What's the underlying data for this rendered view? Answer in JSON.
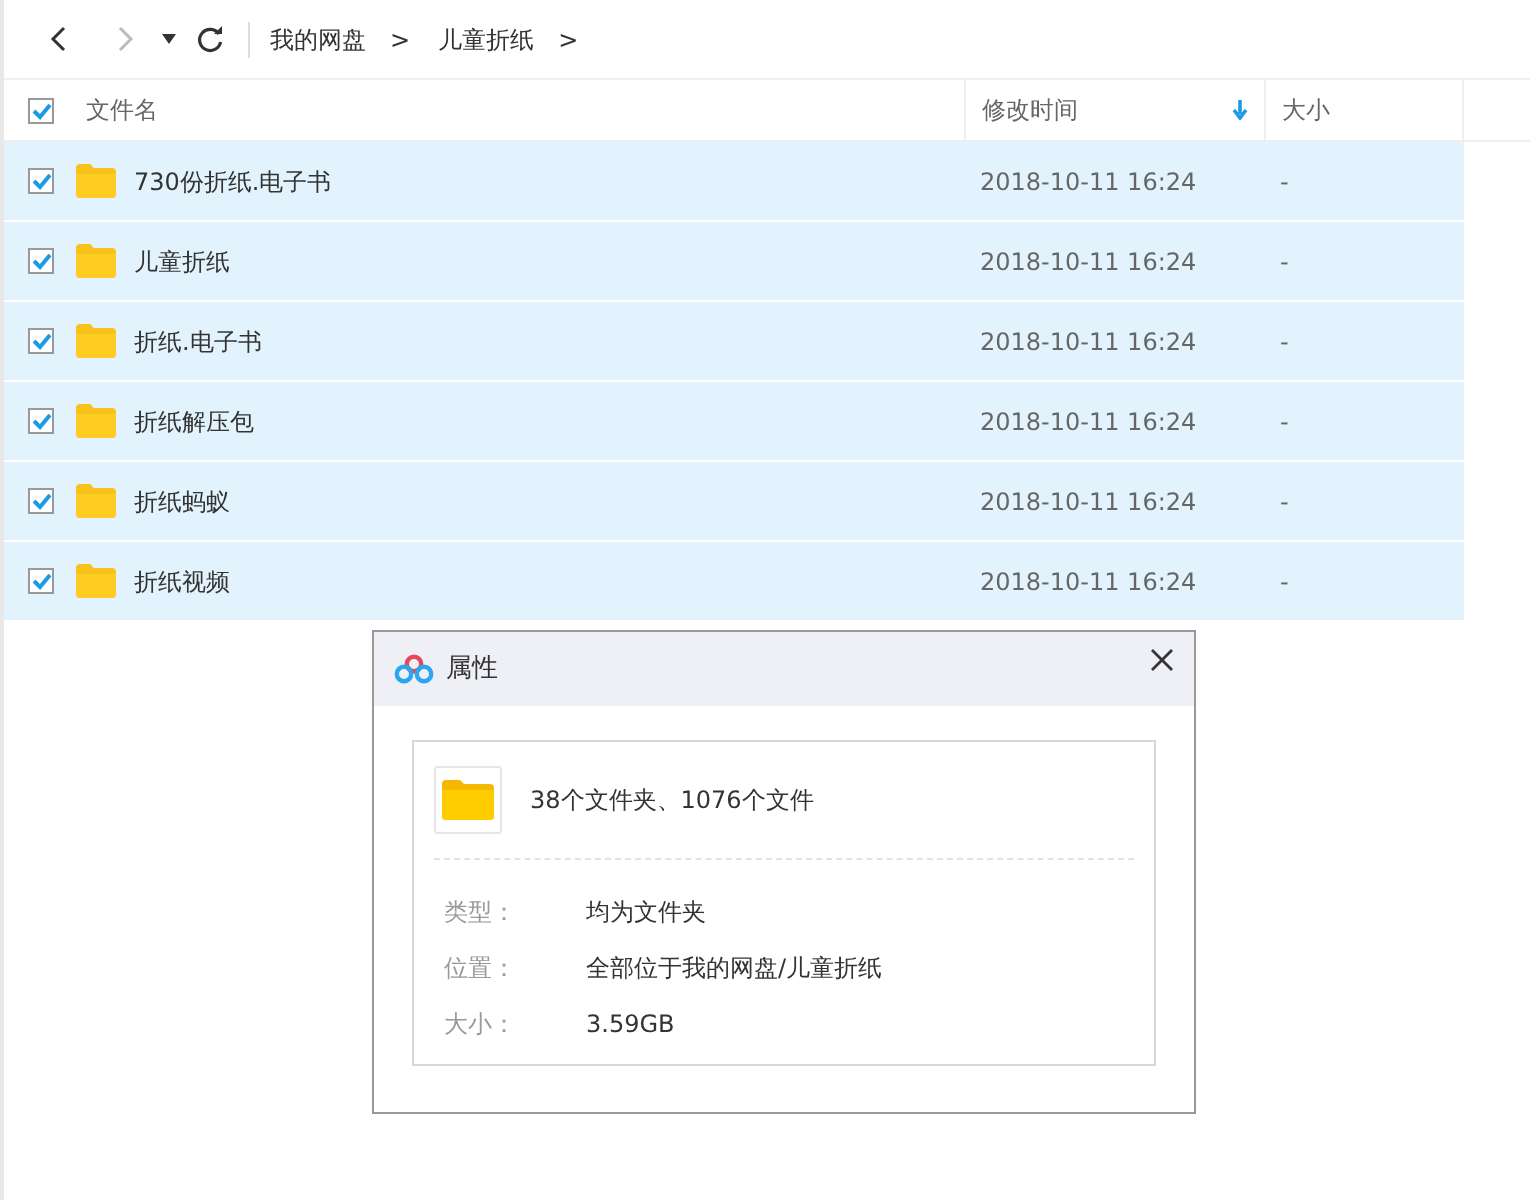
{
  "toolbar": {
    "back_disabled": false,
    "forward_disabled": true,
    "breadcrumbs": [
      {
        "label": "我的网盘",
        "separator": ">"
      },
      {
        "label": "儿童折纸",
        "separator": ">"
      }
    ]
  },
  "header": {
    "select_all_checked": true,
    "columns": [
      {
        "label": "文件名",
        "sorted": false
      },
      {
        "label": "修改时间",
        "sorted": true
      },
      {
        "label": "大小",
        "sorted": false
      }
    ]
  },
  "rows": [
    {
      "name": "730份折纸.电子书",
      "modified": "2018-10-11 16:24",
      "size": "-",
      "selected": true
    },
    {
      "name": "儿童折纸",
      "modified": "2018-10-11 16:24",
      "size": "-",
      "selected": true
    },
    {
      "name": "折纸.电子书",
      "modified": "2018-10-11 16:24",
      "size": "-",
      "selected": true
    },
    {
      "name": "折纸解压包",
      "modified": "2018-10-11 16:24",
      "size": "-",
      "selected": true
    },
    {
      "name": "折纸蚂蚁",
      "modified": "2018-10-11 16:24",
      "size": "-",
      "selected": true
    },
    {
      "name": "折纸视频",
      "modified": "2018-10-11 16:24",
      "size": "-",
      "selected": true
    }
  ],
  "dialog": {
    "title": "属性",
    "summary": "38个文件夹、1076个文件",
    "properties": [
      {
        "label": "类型：",
        "value": "均为文件夹"
      },
      {
        "label": "位置：",
        "value": "全部位于我的网盘/儿童折纸"
      },
      {
        "label": "大小：",
        "value": "3.59GB"
      }
    ]
  }
}
